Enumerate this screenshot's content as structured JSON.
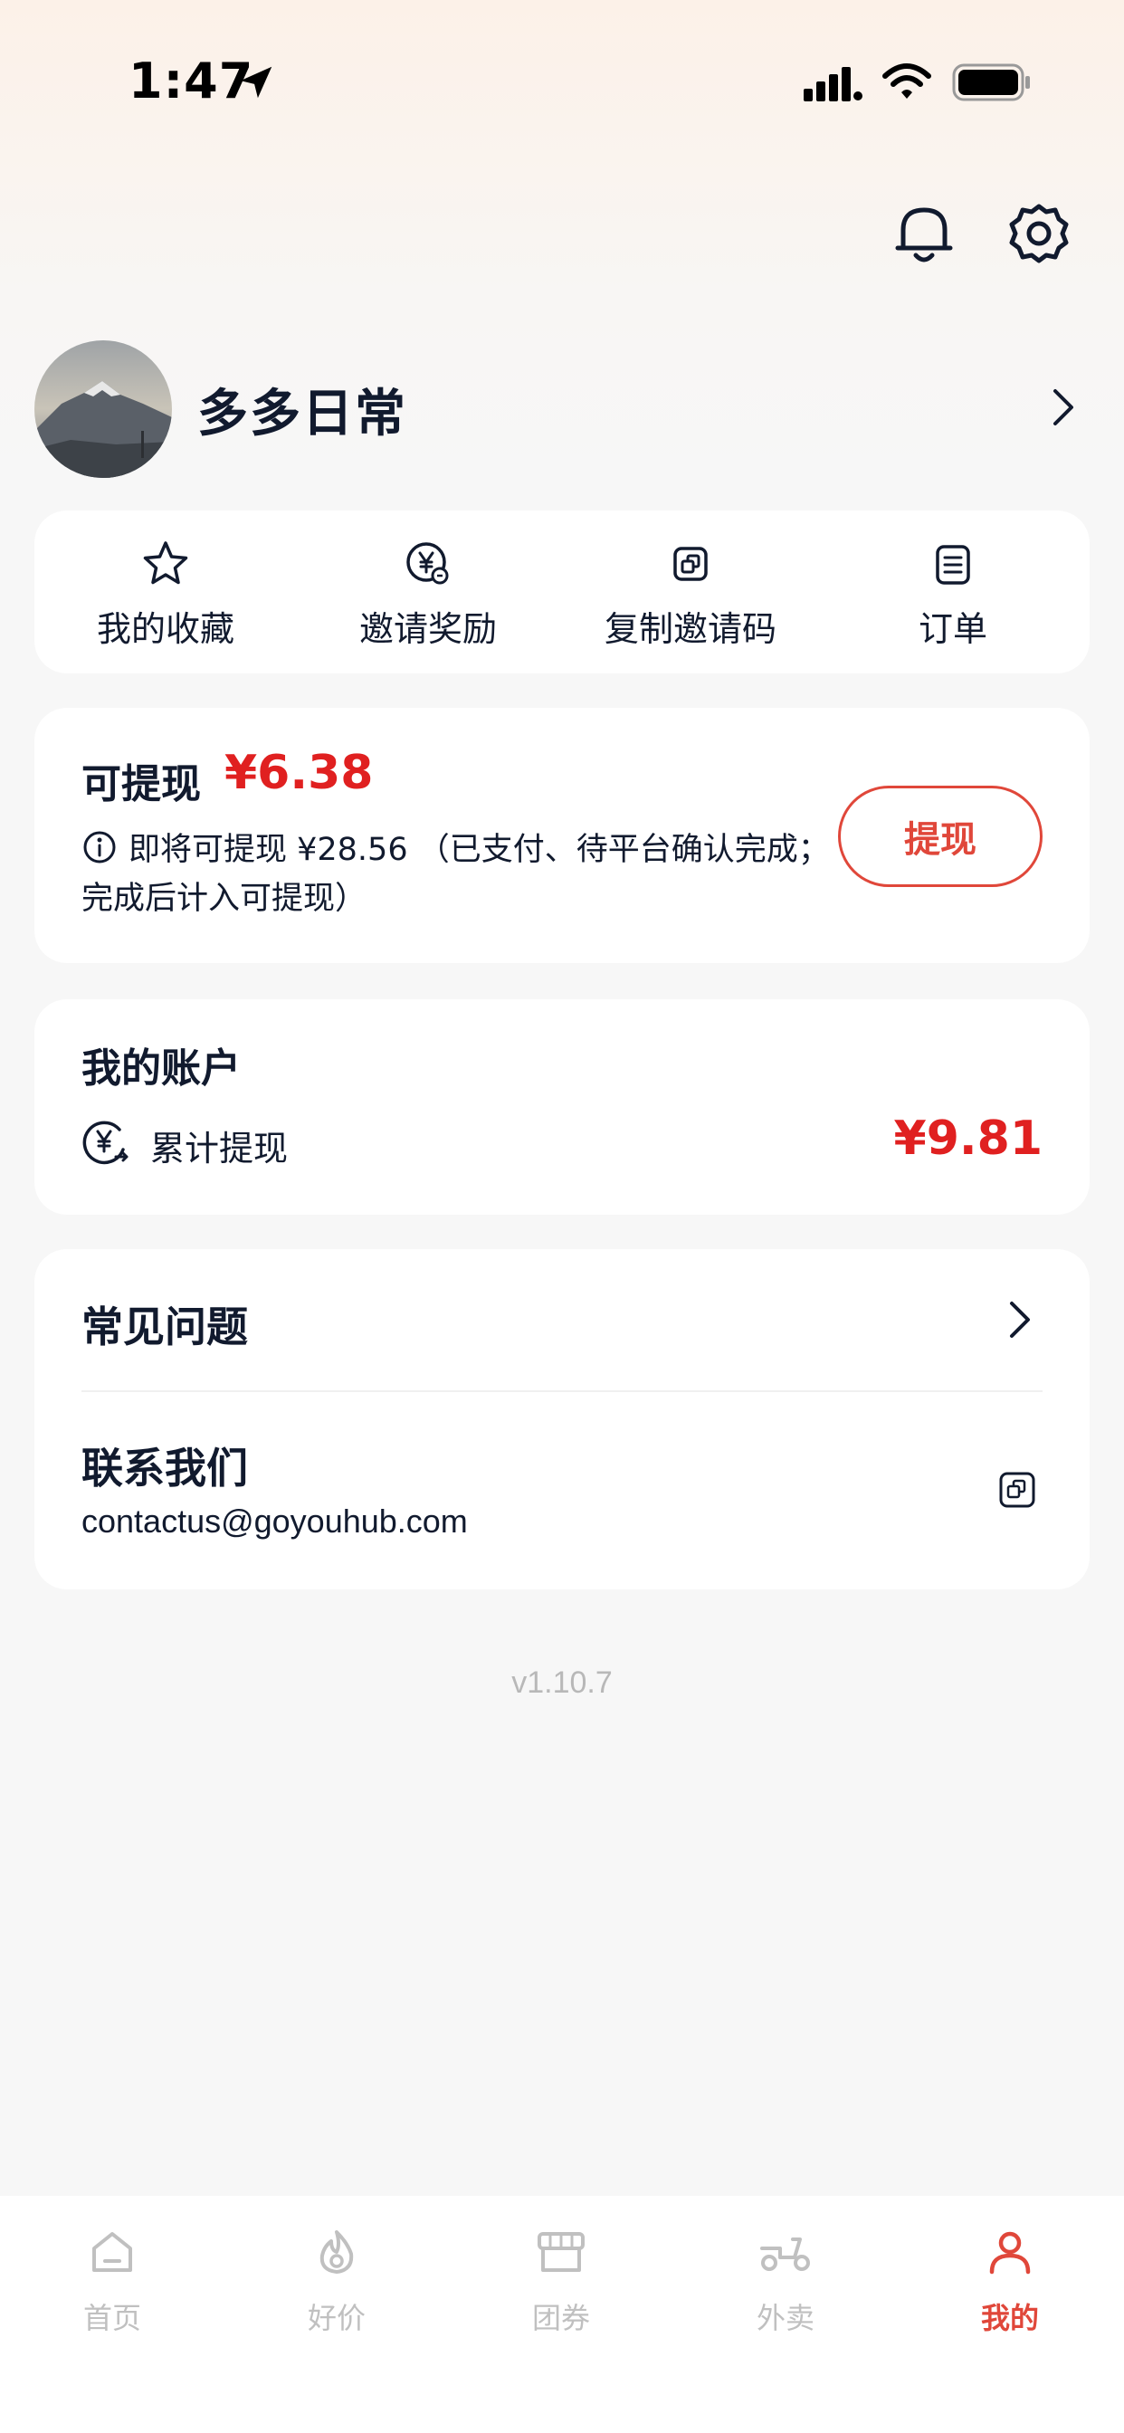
{
  "status_bar": {
    "time": "1:47"
  },
  "profile": {
    "username": "多多日常"
  },
  "quick_actions": [
    {
      "label": "我的收藏",
      "icon": "star-icon"
    },
    {
      "label": "邀请奖励",
      "icon": "yen-reward-icon"
    },
    {
      "label": "复制邀请码",
      "icon": "copy-icon"
    },
    {
      "label": "订单",
      "icon": "order-list-icon"
    }
  ],
  "withdraw": {
    "title": "可提现",
    "amount": "¥6.38",
    "pending_text": "即将可提现 ¥28.56 （已支付、待平台确认完成；完成后计入可提现）",
    "button_label": "提现"
  },
  "account": {
    "title": "我的账户",
    "total_label": "累计提现",
    "total_value": "¥9.81"
  },
  "help": {
    "faq_label": "常见问题",
    "contact_label": "联系我们",
    "contact_email": "contactus@goyouhub.com"
  },
  "version": "v1.10.7",
  "tabbar": [
    {
      "label": "首页",
      "icon": "home-icon"
    },
    {
      "label": "好价",
      "icon": "flame-icon"
    },
    {
      "label": "团券",
      "icon": "store-icon"
    },
    {
      "label": "外卖",
      "icon": "scooter-icon"
    },
    {
      "label": "我的",
      "icon": "person-icon",
      "active": true
    }
  ],
  "colors": {
    "accent_red": "#e02020",
    "button_red": "#e0473a",
    "text_dark": "#111a2e",
    "inactive_gray": "#c0c0c0"
  }
}
